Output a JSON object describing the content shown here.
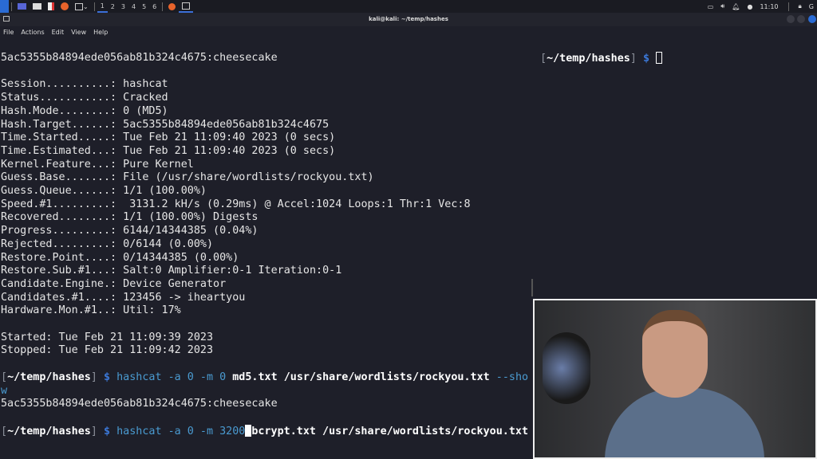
{
  "taskbar": {
    "workspaces": [
      "1",
      "2",
      "3",
      "4",
      "5",
      "6"
    ],
    "clock": "11:10"
  },
  "window": {
    "title": "kali@kali: ~/temp/hashes"
  },
  "menu": [
    "File",
    "Actions",
    "Edit",
    "View",
    "Help"
  ],
  "left": {
    "first_line": "5ac5355b84894ede056ab81b324c4675:cheesecake",
    "status": [
      "Session..........: hashcat",
      "Status...........: Cracked",
      "Hash.Mode........: 0 (MD5)",
      "Hash.Target......: 5ac5355b84894ede056ab81b324c4675",
      "Time.Started.....: Tue Feb 21 11:09:40 2023 (0 secs)",
      "Time.Estimated...: Tue Feb 21 11:09:40 2023 (0 secs)",
      "Kernel.Feature...: Pure Kernel",
      "Guess.Base.......: File (/usr/share/wordlists/rockyou.txt)",
      "Guess.Queue......: 1/1 (100.00%)",
      "Speed.#1.........:  3131.2 kH/s (0.29ms) @ Accel:1024 Loops:1 Thr:1 Vec:8",
      "Recovered........: 1/1 (100.00%) Digests",
      "Progress.........: 6144/14344385 (0.04%)",
      "Rejected.........: 0/6144 (0.00%)",
      "Restore.Point....: 0/14344385 (0.00%)",
      "Restore.Sub.#1...: Salt:0 Amplifier:0-1 Iteration:0-1",
      "Candidate.Engine.: Device Generator",
      "Candidates.#1....: 123456 -> iheartyou",
      "Hardware.Mon.#1..: Util: 17%"
    ],
    "started": "Started: Tue Feb 21 11:09:39 2023",
    "stopped": "Stopped: Tue Feb 21 11:09:42 2023",
    "prompt_path": "~/temp/hashes",
    "cmd1": {
      "name": "hashcat -a 0 -m 0 ",
      "args": "md5.txt /usr/share/wordlists/rockyou.txt",
      "flag": " --sho",
      "wrap": "w"
    },
    "result": "5ac5355b84894ede056ab81b324c4675:cheesecake",
    "cmd2": {
      "name": "hashcat -a 0 -m 3200",
      "args": "bcrypt.txt /usr/share/wordlists/rockyou.txt"
    }
  },
  "right": {
    "prompt_path": "~/temp/hashes"
  }
}
